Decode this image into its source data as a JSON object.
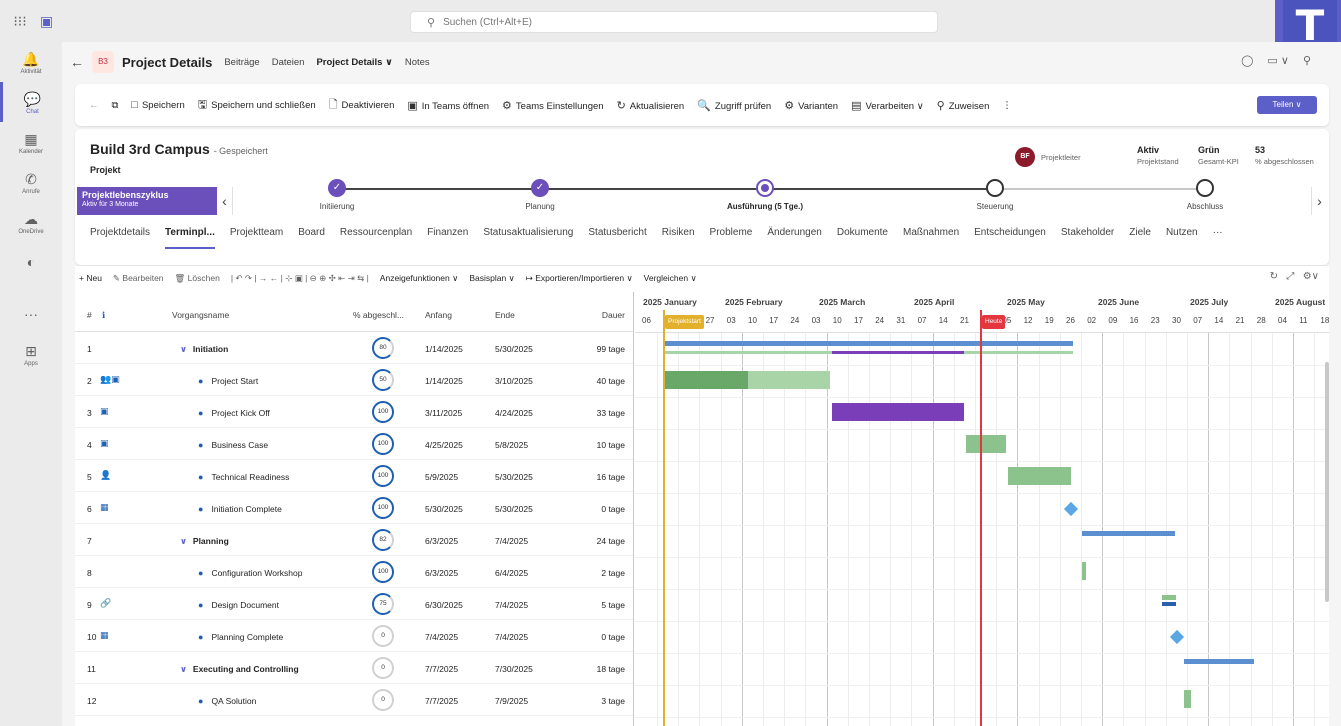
{
  "search": {
    "placeholder": "Suchen (Ctrl+Alt+E)"
  },
  "rail": [
    {
      "icon": "bell-icon",
      "glyph": "🔔",
      "label": "Aktivität",
      "active": false
    },
    {
      "icon": "chat-icon",
      "glyph": "💬",
      "label": "Chat",
      "active": true
    },
    {
      "icon": "calendar-icon",
      "glyph": "▦",
      "label": "Kalender",
      "active": false
    },
    {
      "icon": "phone-icon",
      "glyph": "✆",
      "label": "Anrufe",
      "active": false
    },
    {
      "icon": "cloud-icon",
      "glyph": "☁",
      "label": "OneDrive",
      "active": false
    },
    {
      "icon": "app-icon",
      "glyph": "◐",
      "label": "",
      "active": false
    },
    {
      "icon": "more-icon",
      "glyph": "···",
      "label": "",
      "active": false
    },
    {
      "icon": "apps-icon",
      "glyph": "⊞",
      "label": "Apps",
      "active": false
    }
  ],
  "header": {
    "badge": "B3",
    "title": "Project Details",
    "tabs": [
      "Beiträge",
      "Dateien",
      "Project Details ∨",
      "Notes"
    ]
  },
  "commands": [
    {
      "icon": "□",
      "label": "Speichern"
    },
    {
      "icon": "🖫",
      "label": "Speichern und schließen"
    },
    {
      "icon": "🗋",
      "label": "Deaktivieren"
    },
    {
      "icon": "▣",
      "label": "In Teams öffnen"
    },
    {
      "icon": "⚙",
      "label": "Teams Einstellungen"
    },
    {
      "icon": "↻",
      "label": "Aktualisieren"
    },
    {
      "icon": "🔍",
      "label": "Zugriff prüfen"
    },
    {
      "icon": "⚙",
      "label": "Varianten"
    },
    {
      "icon": "▤",
      "label": "Verarbeiten ∨"
    },
    {
      "icon": "⚲",
      "label": "Zuweisen"
    }
  ],
  "share_label": "Teilen ∨",
  "project": {
    "name": "Build 3rd Campus",
    "saved": "- Gespeichert",
    "type": "Projekt",
    "owner_initials": "BF",
    "owner_role": "Projektleiter",
    "kpis": [
      {
        "value": "Aktiv",
        "label": "Projektstand"
      },
      {
        "value": "Grün",
        "label": "Gesamt-KPI"
      },
      {
        "value": "53",
        "label": "% abgeschlossen"
      }
    ]
  },
  "lifecycle": {
    "title": "Projektlebenszyklus",
    "subtitle": "Aktiv für 3 Monate",
    "stages": [
      {
        "label": "Initiierung",
        "state": "done"
      },
      {
        "label": "Planung",
        "state": "done"
      },
      {
        "label": "Ausführung (5 Tge.)",
        "state": "current"
      },
      {
        "label": "Steuerung",
        "state": "todo"
      },
      {
        "label": "Abschluss",
        "state": "todo"
      }
    ]
  },
  "project_tabs": [
    "Projektdetails",
    "Terminpl...",
    "Projektteam",
    "Board",
    "Ressourcenplan",
    "Finanzen",
    "Statusaktualisierung",
    "Statusbericht",
    "Risiken",
    "Probleme",
    "Änderungen",
    "Dokumente",
    "Maßnahmen",
    "Entscheidungen",
    "Stakeholder",
    "Ziele",
    "Nutzen",
    "···"
  ],
  "grid_toolbar": [
    {
      "label": "+ Neu",
      "on": true
    },
    {
      "label": "✎ Bearbeiten",
      "on": false
    },
    {
      "label": "🗑 Löschen",
      "on": false
    },
    {
      "label": "|  ↶  ↷  |  →  ←  |  ⊹  ▣  |  ⊖  ⊕  ✣  ⇤  ⇥  ⇆  |",
      "on": false
    },
    {
      "label": "Anzeigefunktionen ∨",
      "on": true
    },
    {
      "label": "Basisplan ∨",
      "on": true
    },
    {
      "label": "↦ Exportieren/Importieren ∨",
      "on": true
    },
    {
      "label": "Vergleichen ∨",
      "on": true
    }
  ],
  "columns": {
    "num": "#",
    "info": "ℹ",
    "name": "Vorgangsname",
    "pct": "% abgeschl...",
    "start": "Anfang",
    "end": "Ende",
    "dur": "Dauer"
  },
  "rows": [
    {
      "n": "1",
      "icon": "",
      "name": "Initiation",
      "summary": true,
      "indent": 0,
      "pct": "80",
      "pv": 80,
      "start": "1/14/2025",
      "end": "5/30/2025",
      "dur": "99 tage"
    },
    {
      "n": "2",
      "icon": "👥▣",
      "name": "Project Start",
      "summary": false,
      "indent": 1,
      "pct": "50",
      "pv": 50,
      "start": "1/14/2025",
      "end": "3/10/2025",
      "dur": "40 tage"
    },
    {
      "n": "3",
      "icon": "▣",
      "name": "Project Kick Off",
      "summary": false,
      "indent": 1,
      "pct": "100",
      "pv": 100,
      "start": "3/11/2025",
      "end": "4/24/2025",
      "dur": "33 tage"
    },
    {
      "n": "4",
      "icon": "▣",
      "name": "Business Case",
      "summary": false,
      "indent": 1,
      "pct": "100",
      "pv": 100,
      "start": "4/25/2025",
      "end": "5/8/2025",
      "dur": "10 tage"
    },
    {
      "n": "5",
      "icon": "👤",
      "name": "Technical Readiness",
      "summary": false,
      "indent": 1,
      "pct": "100",
      "pv": 100,
      "start": "5/9/2025",
      "end": "5/30/2025",
      "dur": "16 tage"
    },
    {
      "n": "6",
      "icon": "▦",
      "name": "Initiation Complete",
      "summary": false,
      "indent": 1,
      "pct": "100",
      "pv": 100,
      "start": "5/30/2025",
      "end": "5/30/2025",
      "dur": "0 tage"
    },
    {
      "n": "7",
      "icon": "",
      "name": "Planning",
      "summary": true,
      "indent": 0,
      "pct": "82",
      "pv": 82,
      "start": "6/3/2025",
      "end": "7/4/2025",
      "dur": "24 tage"
    },
    {
      "n": "8",
      "icon": "",
      "name": "Configuration Workshop",
      "summary": false,
      "indent": 1,
      "pct": "100",
      "pv": 100,
      "start": "6/3/2025",
      "end": "6/4/2025",
      "dur": "2 tage"
    },
    {
      "n": "9",
      "icon": "🔗",
      "name": "Design Document",
      "summary": false,
      "indent": 1,
      "pct": "75",
      "pv": 75,
      "start": "6/30/2025",
      "end": "7/4/2025",
      "dur": "5 tage"
    },
    {
      "n": "10",
      "icon": "▦",
      "name": "Planning Complete",
      "summary": false,
      "indent": 1,
      "pct": "0",
      "pv": 0,
      "start": "7/4/2025",
      "end": "7/4/2025",
      "dur": "0 tage"
    },
    {
      "n": "11",
      "icon": "",
      "name": "Executing and Controlling",
      "summary": true,
      "indent": 0,
      "pct": "0",
      "pv": 0,
      "start": "7/7/2025",
      "end": "7/30/2025",
      "dur": "18 tage"
    },
    {
      "n": "12",
      "icon": "",
      "name": "QA Solution",
      "summary": false,
      "indent": 1,
      "pct": "0",
      "pv": 0,
      "start": "7/7/2025",
      "end": "7/9/2025",
      "dur": "3 tage"
    }
  ],
  "gantt": {
    "months": [
      "2025 January",
      "2025 February",
      "2025 March",
      "2025 April",
      "2025 May",
      "2025 June",
      "2025 July",
      "2025 August"
    ],
    "days": [
      "06",
      "13",
      "20",
      "27",
      "03",
      "10",
      "17",
      "24",
      "03",
      "10",
      "17",
      "24",
      "31",
      "07",
      "14",
      "21",
      "28",
      "05",
      "12",
      "19",
      "26",
      "02",
      "09",
      "16",
      "23",
      "30",
      "07",
      "14",
      "21",
      "28",
      "04",
      "11",
      "18"
    ],
    "start_label": "Projektstart",
    "today_label": "Heute",
    "colors": {
      "summary": "#5b8fd0",
      "green": "#8cc38c",
      "green_dark": "#6aa86a",
      "purple": "#7a3fb8",
      "milestone": "#5ba7e6"
    }
  }
}
